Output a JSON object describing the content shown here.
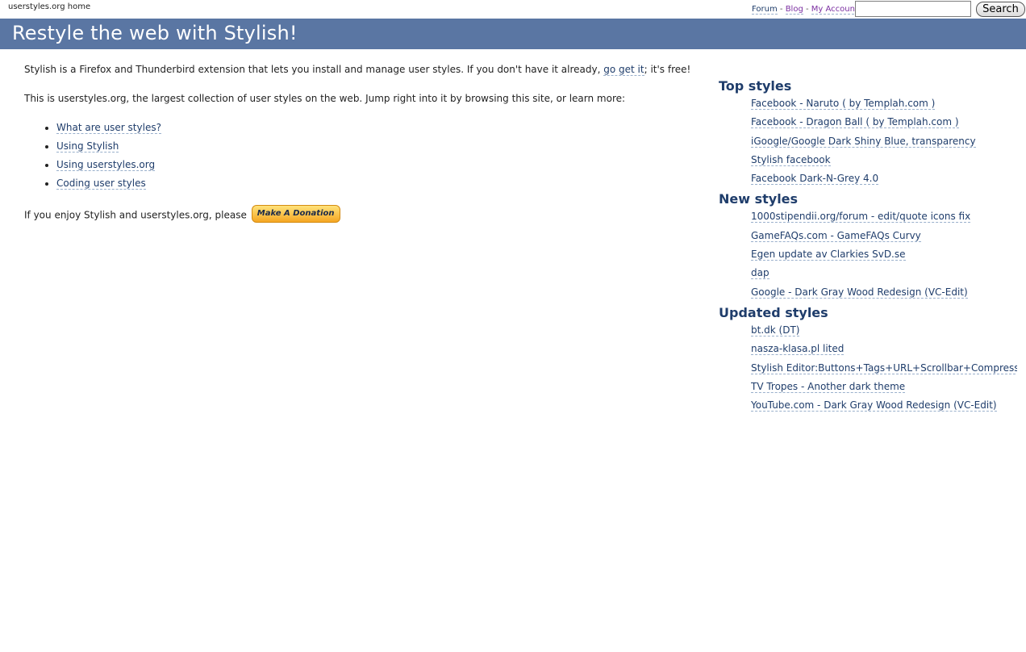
{
  "topbar": {
    "home_link": "userstyles.org home",
    "forum": "Forum",
    "blog": "Blog",
    "my_account": "My Account",
    "separator": " - ",
    "search_value": "",
    "search_button": "Search"
  },
  "banner": {
    "title": "Restyle the web with Stylish!"
  },
  "main": {
    "intro1_prefix": "Stylish is a Firefox and Thunderbird extension that lets you install and manage user styles. If you don't have it already, ",
    "intro1_link": "go get it",
    "intro1_suffix": "; it's free!",
    "intro2": "This is userstyles.org, the largest collection of user styles on the web. Jump right into it by browsing this site, or learn more:",
    "learn_links": [
      "What are user styles?",
      "Using Stylish",
      "Using userstyles.org",
      "Coding user styles"
    ],
    "donate_text": "If you enjoy Stylish and userstyles.org, please ",
    "donate_button": "Make A Donation"
  },
  "sidebar": {
    "top_title": "Top styles",
    "top": [
      "Facebook - Naruto ( by Templah.com )",
      "Facebook - Dragon Ball ( by Templah.com )",
      "iGoogle/Google Dark Shiny Blue, transparency",
      "Stylish facebook",
      "Facebook Dark-N-Grey 4.0"
    ],
    "new_title": "New styles",
    "new": [
      "1000stipendii.org/forum - edit/quote icons fix",
      "GameFAQs.com - GameFAQs Curvy",
      "Egen update av Clarkies SvD.se",
      "dap",
      "Google - Dark Gray Wood Redesign (VC-Edit)"
    ],
    "updated_title": "Updated styles",
    "updated": [
      "bt.dk (DT)",
      "nasza-klasa.pl lited",
      "Stylish Editor:Buttons+Tags+URL+Scrollbar+Compress",
      "TV Tropes - Another dark theme",
      "YouTube.com - Dark Gray Wood Redesign (VC-Edit)"
    ]
  },
  "colors": {
    "banner": "#5a76a3",
    "link": "#1f3d6b",
    "visited_link": "#7b2fa1",
    "donate_button": "#f5a623"
  }
}
